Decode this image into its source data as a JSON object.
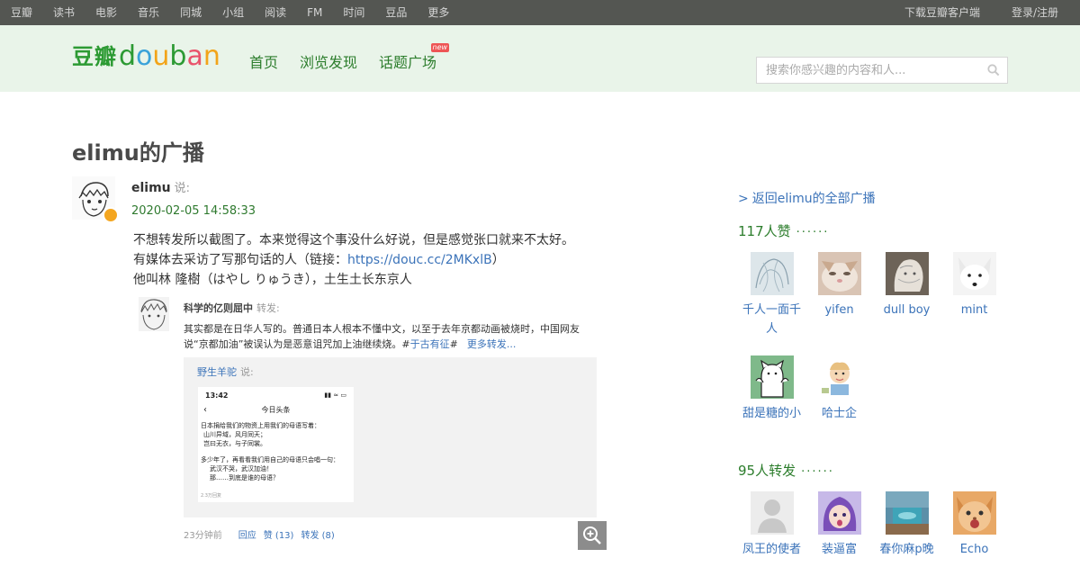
{
  "topnav": {
    "left": [
      "豆瓣",
      "读书",
      "电影",
      "音乐",
      "同城",
      "小组",
      "阅读",
      "FM",
      "时间",
      "豆品",
      "更多"
    ],
    "right": [
      "下载豆瓣客户端",
      "登录/注册"
    ]
  },
  "logo": {
    "cn": "豆瓣",
    "en": [
      "d",
      "o",
      "u",
      "b",
      "a",
      "n"
    ]
  },
  "mainnav": {
    "items": [
      "首页",
      "浏览发现",
      "话题广场"
    ],
    "new_badge": "new"
  },
  "search": {
    "placeholder": "搜索你感兴趣的内容和人..."
  },
  "page": {
    "title": "elimu的广播"
  },
  "status": {
    "author": "elimu",
    "said": "说:",
    "time": "2020-02-05 14:58:33",
    "line1": "不想转发所以截图了。本来觉得这个事没什么好说，但是感觉张口就来不太好。",
    "line2_pre": "有媒体去采访了写那句话的人（链接：",
    "line2_link": "https://douc.cc/2MKxlB",
    "line2_post": "）",
    "line3": "他叫林 隆樹（はやし りゅうき），土生土长东京人"
  },
  "embed": {
    "author": "科学的亿则屈中",
    "said": "转发:",
    "text_main": "其实都是在日华人写的。普通日本人根本不懂中文，以至于去年京都动画被烧时，中国网友说“京都加油”被误认为是恶意诅咒加上油继续烧。#",
    "text_tag": "于古有征",
    "text_hash": "#",
    "text_more": "更多转发...",
    "repost_author": "野生羊驼",
    "repost_said": "说:",
    "phone": {
      "time": "13:42",
      "icons": "▮▮ ≈ ▭",
      "header": "今日头条",
      "back": "‹",
      "lines": [
        "日本捐给我们的物资上用我们的母语写着：",
        "山川异域，风月同天；",
        "岂曰无衣，与子同裳。",
        "",
        "多少年了，再看看我们用自己的母语只会唱一句：",
        "武汉不哭，武汉加油！",
        "那……到底是谁的母语？"
      ],
      "footer": "2.3万回复"
    },
    "footer_time": "23分钟前",
    "footer_reply": "回应",
    "footer_like": "赞 (13)",
    "footer_repost": "转发 (8)"
  },
  "sidebar": {
    "back_arrow": ">",
    "back_label": "返回elimu的全部广播",
    "likes_title": "117人赞",
    "likes_dots": "······",
    "likes": [
      {
        "name": "千人一面千人"
      },
      {
        "name": "yifen"
      },
      {
        "name": "dull boy"
      },
      {
        "name": "mint"
      },
      {
        "name": "甜是糖的小"
      },
      {
        "name": "哈士企"
      }
    ],
    "reposts_title": "95人转发",
    "reposts_dots": "······",
    "reposts": [
      {
        "name": "凤王的使者"
      },
      {
        "name": "装逼富"
      },
      {
        "name": "春你麻p晚"
      },
      {
        "name": "Echo"
      }
    ]
  }
}
